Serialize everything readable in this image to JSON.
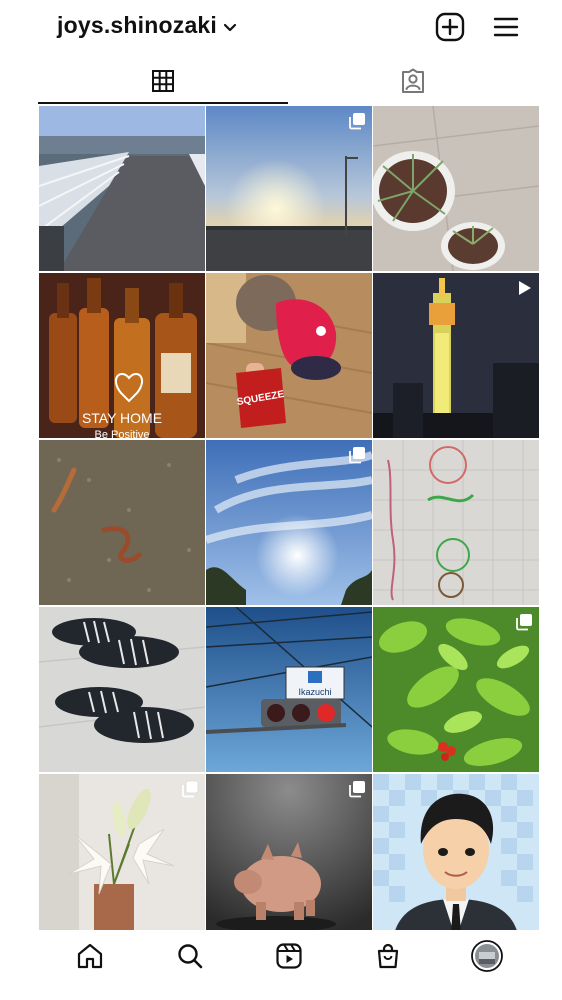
{
  "header": {
    "username": "joys.shinozaki",
    "icons": [
      "chevron-down-icon",
      "plus-square-icon",
      "menu-icon"
    ]
  },
  "tabs": [
    {
      "name": "grid-posts",
      "icon": "grid-icon",
      "active": true
    },
    {
      "name": "tagged",
      "icon": "tagged-person-icon",
      "active": false
    }
  ],
  "posts": [
    {
      "subject": "bridge walkway",
      "badge": "none"
    },
    {
      "subject": "sunset sky",
      "badge": "multiple"
    },
    {
      "subject": "potted air plants",
      "badge": "none"
    },
    {
      "subject": "whisky bottles",
      "badge": "none",
      "overlay_text": "STAY HOME",
      "overlay_text2": "Be Positive"
    },
    {
      "subject": "baby with snack bag",
      "badge": "none",
      "overlay_text": "SQUEEZE"
    },
    {
      "subject": "illuminated tower at night",
      "badge": "video"
    },
    {
      "subject": "worms on ground",
      "badge": "none"
    },
    {
      "subject": "cloudy sky",
      "badge": "multiple"
    },
    {
      "subject": "child's drawing",
      "badge": "none"
    },
    {
      "subject": "striped slippers",
      "badge": "none"
    },
    {
      "subject": "traffic light",
      "badge": "none",
      "overlay_text": "Ikazuchi"
    },
    {
      "subject": "tomato plant",
      "badge": "multiple"
    },
    {
      "subject": "white lilies",
      "badge": "multiple"
    },
    {
      "subject": "pig figurine",
      "badge": "multiple"
    },
    {
      "subject": "cartoon portrait",
      "badge": "none"
    }
  ],
  "bottom_nav": [
    {
      "name": "home",
      "icon": "home-icon"
    },
    {
      "name": "search",
      "icon": "search-icon"
    },
    {
      "name": "reels",
      "icon": "reels-icon"
    },
    {
      "name": "shop",
      "icon": "shop-bag-icon"
    },
    {
      "name": "profile",
      "icon": "profile-avatar-icon"
    }
  ],
  "colors": {
    "text": "#111111",
    "background": "#ffffff"
  }
}
